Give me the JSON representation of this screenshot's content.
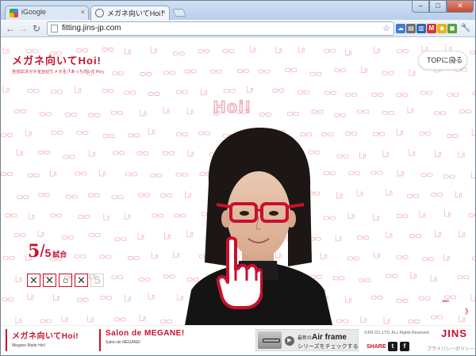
{
  "browser": {
    "tabs": [
      {
        "label": "iGoogle",
        "active": false
      },
      {
        "label": "メガネ向いてHoi！ / Salon",
        "active": true
      }
    ],
    "url": "fitting.jins-jp.com",
    "window_buttons": {
      "minimize": "‒",
      "maximize": "□",
      "close": "✕"
    },
    "tab_close": "×",
    "nav_icons": {
      "back": "←",
      "forward": "→",
      "reload": "↻",
      "star": "☆",
      "wrench": "🔧"
    },
    "extension_icons": [
      {
        "name": "cloud-extension-icon",
        "color": "#3b7dd8",
        "glyph": "☁"
      },
      {
        "name": "bookmark-extension-icon",
        "color": "#6d6d6d",
        "glyph": "▤"
      },
      {
        "name": "dictionary-extension-icon",
        "color": "#2a65b5",
        "glyph": "▥"
      },
      {
        "name": "gmail-extension-icon",
        "color": "#d13a2d",
        "glyph": "M"
      },
      {
        "name": "tag-extension-icon",
        "color": "#e9b514",
        "glyph": "◆"
      },
      {
        "name": "evernote-extension-icon",
        "color": "#53a13a",
        "glyph": "◼"
      }
    ]
  },
  "page": {
    "brand_title": "メガネ向いてHoi!",
    "brand_subtitle": "自分にメガネをかけてメガネ「あっち向いてHoi」",
    "top_button": "TOPに戻る",
    "top_button_chevron": "〉",
    "hoi_text": "Hoi!",
    "score": {
      "current": "5",
      "total": "5",
      "word": "試合"
    },
    "results": [
      {
        "mark": "✕",
        "state": "done"
      },
      {
        "mark": "✕",
        "state": "done"
      },
      {
        "mark": "○",
        "state": "done"
      },
      {
        "mark": "✕",
        "state": "done"
      },
      {
        "mark": "5",
        "state": "pending"
      }
    ],
    "corner_badge": "JINS",
    "corner_chevron": "》"
  },
  "footer": {
    "block1_title": "メガネ向いてHoi!",
    "block1_sub": "Megane Muite Hoi!",
    "block2_title": "Salon de MEGANE!",
    "block2_sub": "Salon de MEGANE!",
    "promo_prefix": "最新の",
    "promo_brand": "Air frame",
    "promo_line2": "シリーズをチェックする",
    "promo_arrow": "▶",
    "copyright": "©JIN CO.,LTD. ALL Rights Reserved.",
    "logo": "JINS",
    "share_label": "SHARE",
    "twitter_glyph": "t",
    "facebook_glyph": "f",
    "privacy": "プライバシーポリシー"
  },
  "colors": {
    "brand_red": "#c8102e",
    "pattern_pink": "#f2b6c1"
  }
}
